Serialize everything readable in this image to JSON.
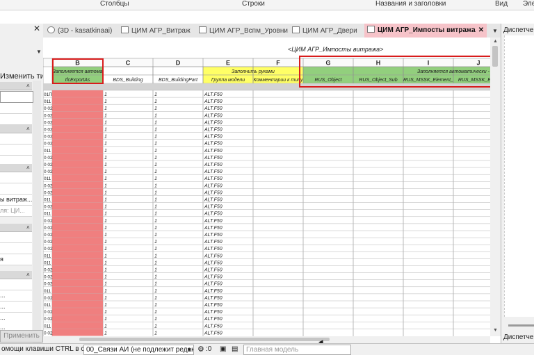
{
  "ribbon": {
    "items": [
      "Столбцы",
      "Строки",
      "Названия и заголовки",
      "Вид",
      "Эле"
    ]
  },
  "properties_panel": {
    "change_type_label": "Изменить тип",
    "apply_label": "Применить",
    "rows": [
      "",
      "",
      "",
      "",
      "",
      "",
      "",
      "",
      "ы витраж...",
      "ля: ЦИ...",
      "",
      "",
      "я",
      "",
      "",
      "",
      "...",
      "...",
      "...",
      "..."
    ]
  },
  "tabs": [
    {
      "label": "(3D - kasatkinaai)",
      "active": false
    },
    {
      "label": "ЦИМ АГР_Витраж",
      "active": false
    },
    {
      "label": "ЦИМ АГР_Вспм_Уровни",
      "active": false
    },
    {
      "label": "ЦИМ АГР_Двери",
      "active": false
    },
    {
      "label": "ЦИМ АГР_Импосты витража",
      "active": true
    }
  ],
  "schedule": {
    "title": "<ЦИМ АГР_Импосты витража>",
    "columns": [
      {
        "letter": "B",
        "group": "Заполняется автома",
        "param": "IfcExportAs",
        "highlight": "green"
      },
      {
        "letter": "C",
        "group": "",
        "param": "BDS_Building",
        "highlight": "none"
      },
      {
        "letter": "D",
        "group": "",
        "param": "BDS_BuildingPart",
        "highlight": "none"
      },
      {
        "letter": "E",
        "group": "Заполнить руками",
        "param": "Группа модели",
        "highlight": "yellow"
      },
      {
        "letter": "F",
        "group": "",
        "param": "Комментарии к типу",
        "highlight": "yellow"
      },
      {
        "letter": "G",
        "group": "",
        "param": "RUS_Object",
        "highlight": "green"
      },
      {
        "letter": "H",
        "group": "",
        "param": "RUS_Object_Sub",
        "highlight": "green"
      },
      {
        "letter": "I",
        "group": "Заполняется автоматически - ",
        "param": "RUS_MSSK_Element_",
        "highlight": "green"
      },
      {
        "letter": "J",
        "group": "",
        "param": "RUS_MSSK_Elem",
        "highlight": "green"
      }
    ],
    "row_values": {
      "a_cells": [
        "01П",
        "011",
        "0 02",
        "0 02",
        "0 02",
        "0 02",
        "0 02",
        "0 02",
        "011",
        "0 02",
        "0 02",
        "0 02",
        "011",
        "0 02",
        "0 02",
        "011",
        "0 02",
        "011",
        "0 02",
        "0 02",
        "0 02",
        "0 02",
        "0 02",
        "011",
        "011",
        "0 02",
        "0 02",
        "0 02",
        "011",
        "0 02",
        "011",
        "0 02",
        "0 02",
        "011",
        "0 02"
      ],
      "building": "1",
      "building_part": "1",
      "model_group": "ALT.F50"
    }
  },
  "project_browser": {
    "title": "Диспетчер",
    "title2": "Диспетчер"
  },
  "status_bar": {
    "hint": "омощи клавиши CTRL в с",
    "workset": "00_Связи АИ (не подлежит редак",
    "zero": ":0",
    "model": "Главная модель"
  },
  "colors": {
    "green_header": "#92cf7d",
    "yellow_header": "#ffff66",
    "red_cells": "#f07f7f",
    "active_tab": "#f6c3c9",
    "annotation": "#d81c1c"
  }
}
